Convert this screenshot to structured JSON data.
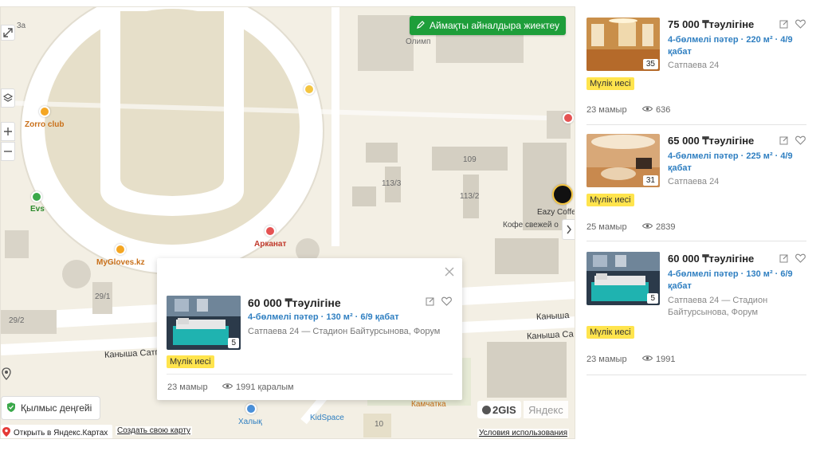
{
  "map": {
    "draw_button": "Аймақты айналдыра жиектеу",
    "crime_level": "Қылмыс деңгейі",
    "open_yandex": "Открыть в Яндекс.Картах",
    "create_map": "Создать свою карту",
    "terms": "Условия использования",
    "logo_2gis": "2GIS",
    "logo_yandex": "Яндекс",
    "labels": {
      "l3a": "3а",
      "zorro": "Zorro club",
      "evs": "Evs",
      "myglovesk": "MyGloves.kz",
      "arkanat": "Арканат",
      "b109": "109",
      "b1133": "113/3",
      "b1132": "113/2",
      "eazy": "Eazy Coffe",
      "coffee_sub": "Кофе свежей о",
      "b291": "29/1",
      "b292": "29/2",
      "kanysha1": "Каныша Сатп",
      "kanysha2": "Каныша",
      "kanysha3": "Каныша Са",
      "halyk": "Халық",
      "kidspace": "KidSpace",
      "kamchatka": "Камчатка",
      "n10": "10",
      "olympic": "Олимп"
    },
    "popup": {
      "price": "60 000 ₸тәулігіне",
      "details": "4-бөлмелі пәтер · 130 м² · 6/9 қабат",
      "address": "Сатпаева 24 — Стадион Байтурсынова, Форум",
      "badge": "Мүлік иесі",
      "photo_count": "5",
      "date": "23 мамыр",
      "views": "1991 қаралым"
    }
  },
  "listings": [
    {
      "price": "75 000 ₸тәулігіне",
      "details": "4-бөлмелі пәтер · 220 м² · 4/9 қабат",
      "address": "Сатпаева 24",
      "badge": "Мүлік иесі",
      "photo_count": "35",
      "date": "23 мамыр",
      "views": "636"
    },
    {
      "price": "65 000 ₸тәулігіне",
      "details": "4-бөлмелі пәтер · 225 м² · 4/9 қабат",
      "address": "Сатпаева 24",
      "badge": "Мүлік иесі",
      "photo_count": "31",
      "date": "25 мамыр",
      "views": "2839"
    },
    {
      "price": "60 000 ₸тәулігіне",
      "details": "4-бөлмелі пәтер · 130 м² · 6/9 қабат",
      "address": "Сатпаева 24 — Стадион Байтурсынова, Форум",
      "badge": "Мүлік иесі",
      "photo_count": "5",
      "date": "23 мамыр",
      "views": "1991"
    }
  ],
  "icons": {
    "pencil": "pencil-icon",
    "eye": "eye-icon",
    "edit": "edit-note-icon",
    "heart": "heart-icon",
    "close": "close-icon",
    "shield": "shield-icon",
    "zoom_in": "plus-icon",
    "zoom_out": "minus-icon",
    "layers": "layers-icon",
    "fullscreen": "expand-icon",
    "location": "location-icon",
    "chevron": "chevron-right-icon"
  },
  "colors": {
    "draw_button": "#1e9e3a",
    "badge": "#ffe44d",
    "link": "#2f7fc1"
  }
}
